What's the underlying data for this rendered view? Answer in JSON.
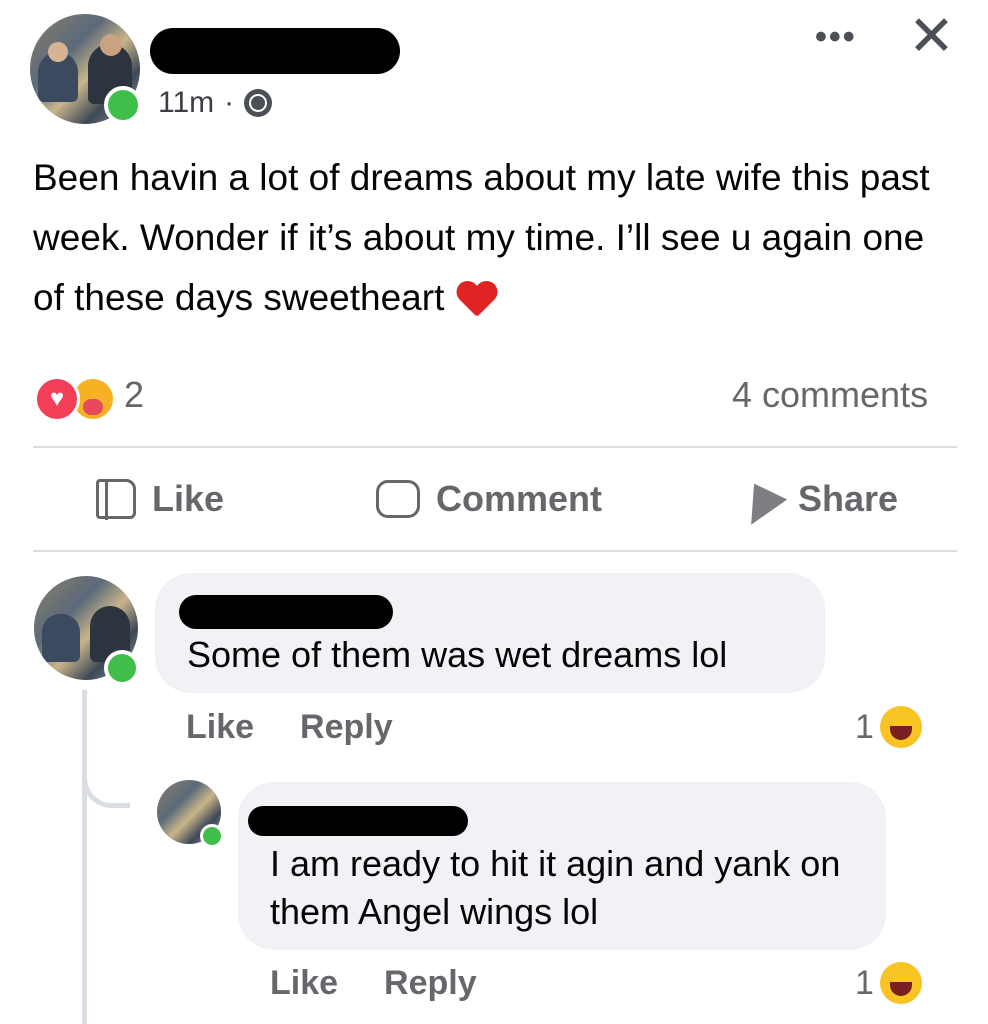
{
  "post": {
    "time": "11m",
    "separator": "·",
    "more_label": "•••",
    "close_label": "✕",
    "text": "Been havin a lot of dreams about my late wife this past week. Wonder if it’s about my time. I’ll see u again one of these days sweetheart",
    "reaction_count": "2",
    "comments_count": "4 comments"
  },
  "actions": {
    "like": "Like",
    "comment": "Comment",
    "share": "Share"
  },
  "comments": [
    {
      "text": "Some of them was wet dreams lol",
      "like_label": "Like",
      "reply_label": "Reply",
      "reaction_count": "1"
    },
    {
      "text": "I am ready to hit it agin and yank on them Angel wings lol",
      "like_label": "Like",
      "reply_label": "Reply",
      "reaction_count": "1"
    }
  ],
  "colors": {
    "online": "#3fbf4a",
    "secondary_text": "#65676b",
    "bubble": "#f0f2f5",
    "love": "#f33e58"
  }
}
